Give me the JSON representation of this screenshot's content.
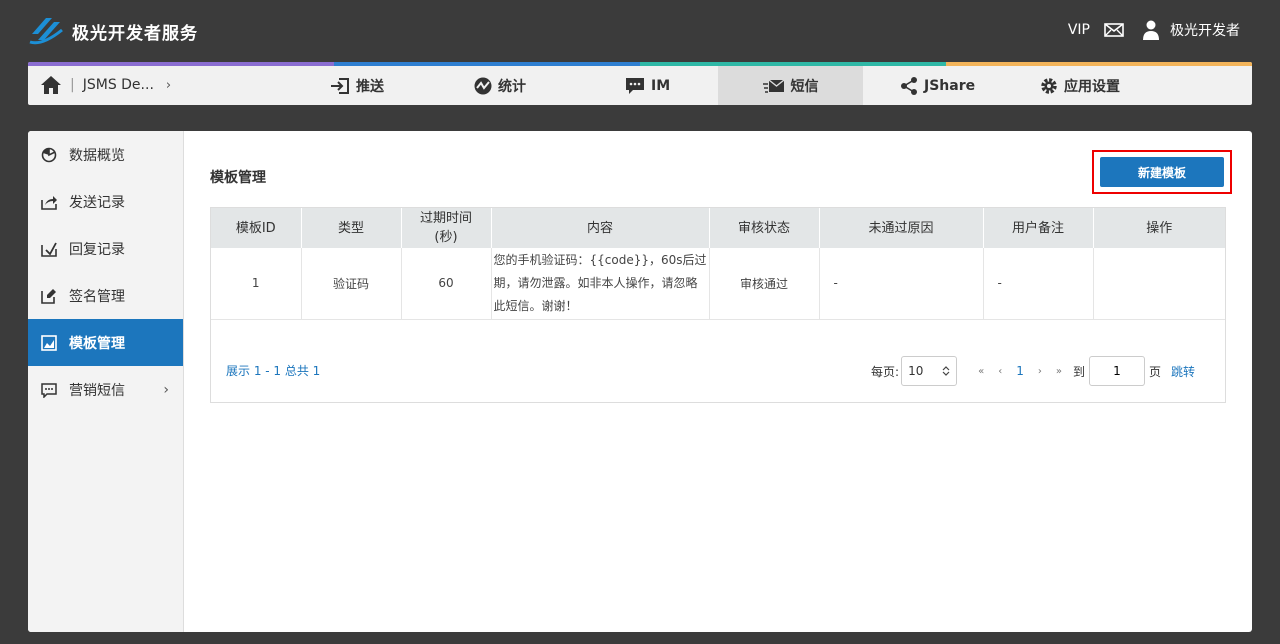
{
  "header": {
    "brand": "极光开发者服务",
    "vip": "VIP",
    "user_name": "极光开发者"
  },
  "nav": {
    "app_name": "JSMS De...",
    "stripe_colors": [
      "#8a6dd1",
      "#2f7fd1",
      "#2fb8a6",
      "#f3b45a"
    ],
    "items": [
      {
        "label": "推送",
        "icon": "push-icon"
      },
      {
        "label": "统计",
        "icon": "stats-icon"
      },
      {
        "label": "IM",
        "icon": "im-icon"
      },
      {
        "label": "短信",
        "icon": "sms-icon",
        "active": true
      },
      {
        "label": "JShare",
        "icon": "share-icon"
      },
      {
        "label": "应用设置",
        "icon": "gear-icon"
      }
    ]
  },
  "sidebar": {
    "items": [
      {
        "label": "数据概览",
        "icon": "pie-chart-icon"
      },
      {
        "label": "发送记录",
        "icon": "send-record-icon"
      },
      {
        "label": "回复记录",
        "icon": "reply-record-icon"
      },
      {
        "label": "签名管理",
        "icon": "signature-icon"
      },
      {
        "label": "模板管理",
        "icon": "template-icon",
        "active": true
      },
      {
        "label": "营销短信",
        "icon": "marketing-sms-icon"
      }
    ]
  },
  "main": {
    "title": "模板管理",
    "new_button": "新建模板",
    "table": {
      "headers": [
        "模板ID",
        "类型",
        "过期时间(秒)",
        "内容",
        "审核状态",
        "未通过原因",
        "用户备注",
        "操作"
      ],
      "rows": [
        {
          "id": "1",
          "type": "验证码",
          "ttl": "60",
          "content": "您的手机验证码：{{code}}，60s后过期，请勿泄露。如非本人操作，请忽略此短信。谢谢！",
          "status": "审核通过",
          "reason": "-",
          "remark": "-",
          "action": ""
        }
      ]
    },
    "pager": {
      "summary": "展示 1 - 1 总共 1",
      "per_page_label": "每页:",
      "per_page_value": "10",
      "first": "«",
      "prev": "‹",
      "current": "1",
      "next": "›",
      "last": "»",
      "to_label": "到",
      "goto_value": "1",
      "page_label": "页",
      "jump_label": "跳转"
    }
  }
}
